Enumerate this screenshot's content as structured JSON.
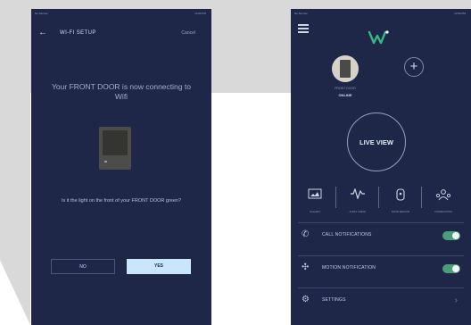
{
  "left_screen": {
    "status_left": "No Service",
    "status_right": "12:00 PM",
    "title": "WI-FI SETUP",
    "cancel_label": "Cancel",
    "message": "Your FRONT DOOR is now connecting to Wifi",
    "question": "Is it the light on the front of your FRONT DOOR green?",
    "no_label": "NO",
    "yes_label": "YES"
  },
  "right_screen": {
    "status_left": "No Service",
    "status_right": "12:00 PM",
    "device_name": "FRONT DOOR",
    "device_status": "ONLINE",
    "add_label": "+",
    "live_view_label": "LIVE VIEW",
    "features": [
      {
        "label": "GALLERY",
        "icon": "gallery-icon"
      },
      {
        "label": "AUDIO CHECK",
        "icon": "audio-check-icon"
      },
      {
        "label": "DOOR SENSOR",
        "icon": "door-sensor-icon"
      },
      {
        "label": "CONNECTIONS",
        "icon": "connections-icon"
      }
    ],
    "rows": [
      {
        "label": "CALL NOTIFICATIONS",
        "icon": "phone-icon",
        "toggle": "on"
      },
      {
        "label": "MOTION NOTIFICATION",
        "icon": "motion-icon",
        "toggle": "on"
      },
      {
        "label": "SETTINGS",
        "icon": "gear-icon"
      }
    ]
  },
  "colors": {
    "app_background": "#1f2749",
    "accent": "#c9e6fb",
    "toggle_on": "#4b9d77",
    "logo_green": "#35b785"
  }
}
